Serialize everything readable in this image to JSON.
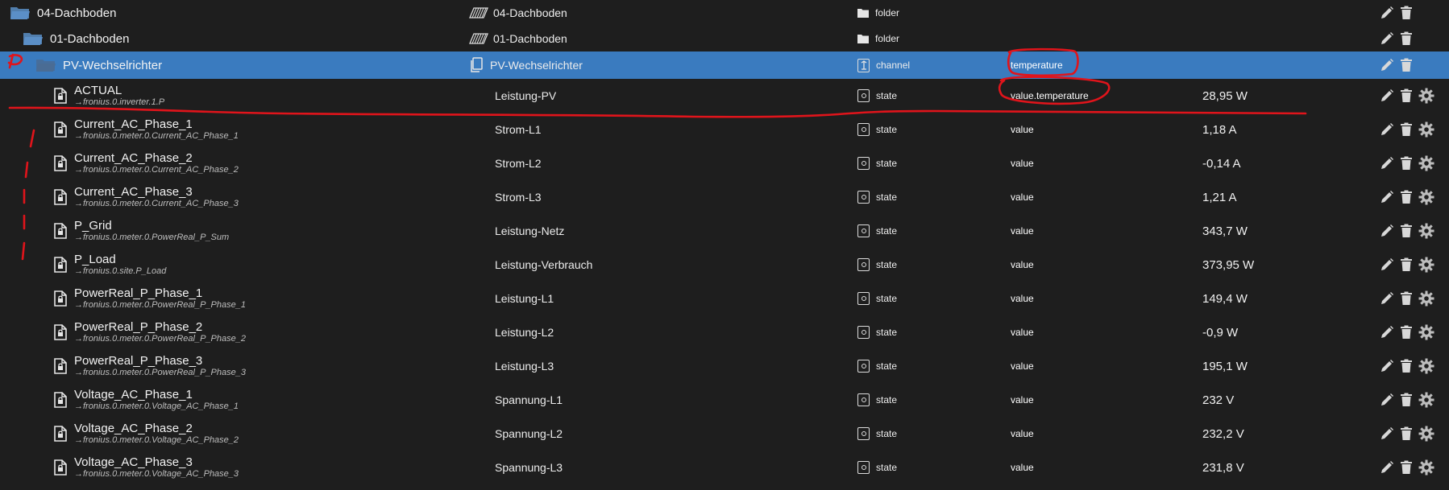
{
  "tree": {
    "rows": [
      {
        "name": "04-Dachboden",
        "sub": "",
        "title": "04-Dachboden",
        "type": "folder",
        "role": "",
        "value": "",
        "kind": "folder",
        "indent": 0
      },
      {
        "name": "01-Dachboden",
        "sub": "",
        "title": "01-Dachboden",
        "type": "folder",
        "role": "",
        "value": "",
        "kind": "folder",
        "indent": 1
      },
      {
        "name": "PV-Wechselrichter",
        "sub": "",
        "title": "PV-Wechselrichter",
        "type": "channel",
        "role": "temperature",
        "value": "",
        "kind": "channel",
        "indent": 2,
        "selected": true
      },
      {
        "name": "ACTUAL",
        "sub": "→fronius.0.inverter.1.P",
        "title": "Leistung-PV",
        "type": "state",
        "role": "value.temperature",
        "value": "28,95 W",
        "kind": "state"
      },
      {
        "name": "Current_AC_Phase_1",
        "sub": "→fronius.0.meter.0.Current_AC_Phase_1",
        "title": "Strom-L1",
        "type": "state",
        "role": "value",
        "value": "1,18 A",
        "kind": "state"
      },
      {
        "name": "Current_AC_Phase_2",
        "sub": "→fronius.0.meter.0.Current_AC_Phase_2",
        "title": "Strom-L2",
        "type": "state",
        "role": "value",
        "value": "-0,14 A",
        "kind": "state"
      },
      {
        "name": "Current_AC_Phase_3",
        "sub": "→fronius.0.meter.0.Current_AC_Phase_3",
        "title": "Strom-L3",
        "type": "state",
        "role": "value",
        "value": "1,21 A",
        "kind": "state"
      },
      {
        "name": "P_Grid",
        "sub": "→fronius.0.meter.0.PowerReal_P_Sum",
        "title": "Leistung-Netz",
        "type": "state",
        "role": "value",
        "value": "343,7 W",
        "kind": "state"
      },
      {
        "name": "P_Load",
        "sub": "→fronius.0.site.P_Load",
        "title": "Leistung-Verbrauch",
        "type": "state",
        "role": "value",
        "value": "373,95 W",
        "kind": "state"
      },
      {
        "name": "PowerReal_P_Phase_1",
        "sub": "→fronius.0.meter.0.PowerReal_P_Phase_1",
        "title": "Leistung-L1",
        "type": "state",
        "role": "value",
        "value": "149,4 W",
        "kind": "state"
      },
      {
        "name": "PowerReal_P_Phase_2",
        "sub": "→fronius.0.meter.0.PowerReal_P_Phase_2",
        "title": "Leistung-L2",
        "type": "state",
        "role": "value",
        "value": "-0,9 W",
        "kind": "state"
      },
      {
        "name": "PowerReal_P_Phase_3",
        "sub": "→fronius.0.meter.0.PowerReal_P_Phase_3",
        "title": "Leistung-L3",
        "type": "state",
        "role": "value",
        "value": "195,1 W",
        "kind": "state"
      },
      {
        "name": "Voltage_AC_Phase_1",
        "sub": "→fronius.0.meter.0.Voltage_AC_Phase_1",
        "title": "Spannung-L1",
        "type": "state",
        "role": "value",
        "value": "232 V",
        "kind": "state"
      },
      {
        "name": "Voltage_AC_Phase_2",
        "sub": "→fronius.0.meter.0.Voltage_AC_Phase_2",
        "title": "Spannung-L2",
        "type": "state",
        "role": "value",
        "value": "232,2 V",
        "kind": "state"
      },
      {
        "name": "Voltage_AC_Phase_3",
        "sub": "→fronius.0.meter.0.Voltage_AC_Phase_3",
        "title": "Spannung-L3",
        "type": "state",
        "role": "value",
        "value": "231,8 V",
        "kind": "state"
      }
    ]
  },
  "colors": {
    "background": "#1e1e1e",
    "selected_row": "#3a7bbf",
    "folder_icon": "#5b8fc7",
    "annotation": "#e0141b"
  },
  "icons": {
    "folder": "folder-open-icon",
    "state": "state-file-icon",
    "edit": "pencil-icon",
    "delete": "trash-icon",
    "settings": "gear-icon"
  }
}
